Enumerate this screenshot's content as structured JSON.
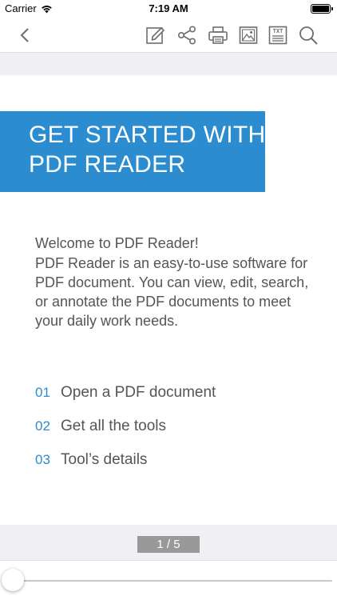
{
  "status_bar": {
    "carrier": "Carrier",
    "time": "7:19 AM",
    "icons": [
      "wifi-icon",
      "battery-icon"
    ]
  },
  "toolbar": {
    "buttons": [
      "back-icon",
      "edit-icon",
      "share-icon",
      "print-icon",
      "image-icon",
      "txt-icon",
      "search-icon"
    ],
    "txt_label": "TXT"
  },
  "document": {
    "hero_line1": "GET STARTED WITH",
    "hero_line2": "PDF READER",
    "welcome": "Welcome to PDF Reader!",
    "description": "PDF Reader is an easy-to-use software for PDF document. You can view, edit, search, or annotate the PDF documents to meet your daily work needs.",
    "toc": [
      {
        "num": "01",
        "label": "Open a PDF document"
      },
      {
        "num": "02",
        "label": "Get all the tools"
      },
      {
        "num": "03",
        "label": "Tool’s details"
      }
    ]
  },
  "pager": {
    "indicator": "1 / 5",
    "current_page": 1,
    "total_pages": 5
  },
  "colors": {
    "accent": "#2b8ccf",
    "icon": "#6d6d6d",
    "indicator_bg": "#999999"
  }
}
